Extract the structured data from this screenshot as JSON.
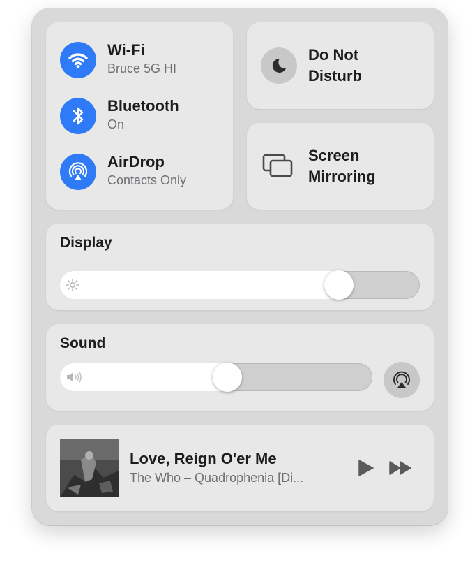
{
  "network": {
    "wifi": {
      "title": "Wi-Fi",
      "subtitle": "Bruce 5G HI",
      "icon": "wifi-icon",
      "active": true
    },
    "bluetooth": {
      "title": "Bluetooth",
      "subtitle": "On",
      "icon": "bluetooth-icon",
      "active": true
    },
    "airdrop": {
      "title": "AirDrop",
      "subtitle": "Contacts Only",
      "icon": "airdrop-icon",
      "active": true
    }
  },
  "do_not_disturb": {
    "line1": "Do Not",
    "line2": "Disturb",
    "icon": "moon-icon",
    "active": false
  },
  "screen_mirroring": {
    "line1": "Screen",
    "line2": "Mirroring",
    "icon": "screen-mirroring-icon"
  },
  "display": {
    "label": "Display",
    "brightness": 0.8,
    "icon": "sun-icon"
  },
  "sound": {
    "label": "Sound",
    "volume": 0.54,
    "icon": "speaker-icon",
    "airplay_icon": "airplay-audio-icon"
  },
  "now_playing": {
    "title": "Love, Reign O'er Me",
    "subtitle": "The Who – Quadrophenia [Di...",
    "play_icon": "play-icon",
    "forward_icon": "fast-forward-icon"
  },
  "colors": {
    "accent": "#2f7af7",
    "tile": "#e8e8e8",
    "panel": "#d9d9d9"
  }
}
